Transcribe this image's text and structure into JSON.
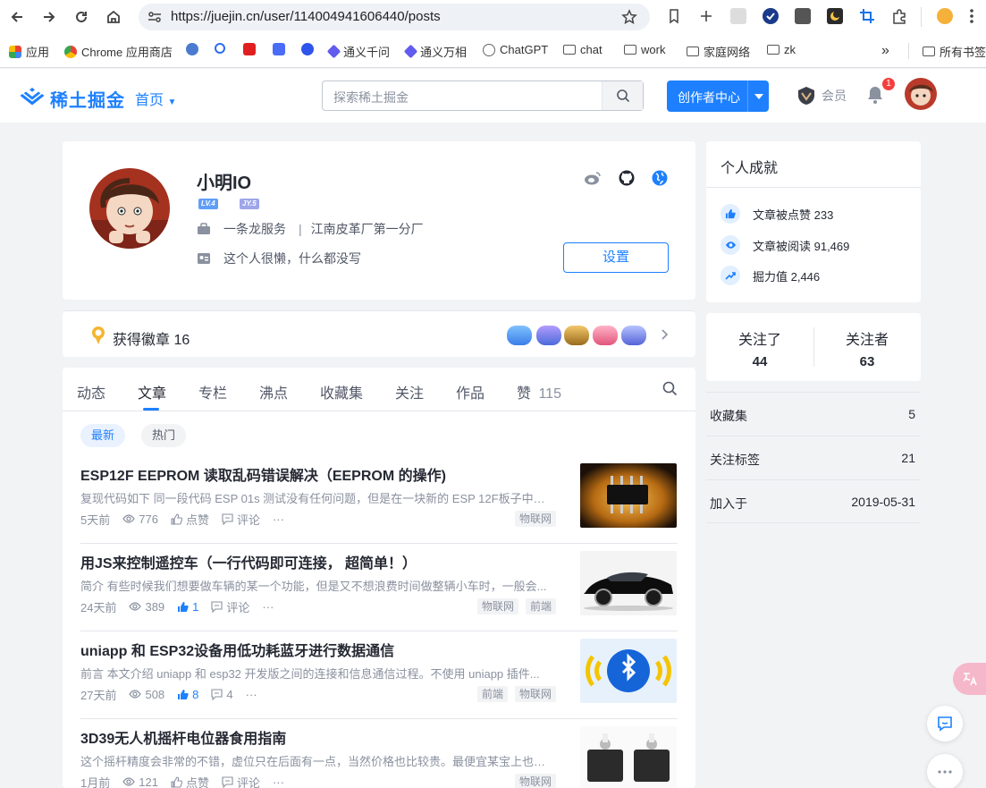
{
  "browser": {
    "url": "https://juejin.cn/user/114004941606440/posts",
    "bookmarks": [
      "应用",
      "Chrome 应用商店",
      "通义千问",
      "通义万相",
      "ChatGPT",
      "chat",
      "work",
      "家庭网络",
      "zk",
      "所有书签"
    ],
    "bookmarks_overflow": "»"
  },
  "header": {
    "logo_text": "稀土掘金",
    "nav_home": "首页",
    "search_placeholder": "探索稀土掘金",
    "creator_button": "创作者中心",
    "vip_label": "会员",
    "notification_count": "1"
  },
  "profile": {
    "name": "小明IO",
    "level_badge": "LV.4",
    "jy_badge": "JY.5",
    "job": "一条龙服务",
    "company": "江南皮革厂第一分厂",
    "bio": "这个人很懒，什么都没写",
    "settings_button": "设置",
    "badges_label": "获得徽章 16"
  },
  "tabs": [
    {
      "label": "动态"
    },
    {
      "label": "文章"
    },
    {
      "label": "专栏"
    },
    {
      "label": "沸点"
    },
    {
      "label": "收藏集"
    },
    {
      "label": "关注"
    },
    {
      "label": "作品"
    },
    {
      "label": "赞",
      "count": "115"
    }
  ],
  "filters": {
    "latest": "最新",
    "hot": "热门"
  },
  "articles": [
    {
      "title": "ESP12F EEPROM 读取乱码错误解决（EEPROM 的操作)",
      "desc": "复现代码如下 同一段代码 ESP 01s 测试没有任何问题，但是在一块新的 ESP 12F板子中出...",
      "time": "5天前",
      "views": "776",
      "likes": "点赞",
      "comments": "评论",
      "more": "···",
      "tags": [
        "物联网"
      ],
      "liked": false
    },
    {
      "title": "用JS来控制遥控车（一行代码即可连接， 超简单！）",
      "desc": "简介 有些时候我们想要做车辆的某一个功能，但是又不想浪费时间做整辆小车时，一般会...",
      "time": "24天前",
      "views": "389",
      "likes": "1",
      "comments": "评论",
      "more": "···",
      "tags": [
        "物联网",
        "前端"
      ],
      "liked": true
    },
    {
      "title": "uniapp 和 ESP32设备用低功耗蓝牙进行数据通信",
      "desc": "前言 本文介绍 uniapp 和 esp32 开发版之间的连接和信息通信过程。不使用 uniapp 插件...",
      "time": "27天前",
      "views": "508",
      "likes": "8",
      "comments": "4",
      "more": "···",
      "tags": [
        "前端",
        "物联网"
      ],
      "liked": true
    },
    {
      "title": "3D39无人机摇杆电位器食用指南",
      "desc": "这个摇杆精度会非常的不错，虚位只在后面有一点，当然价格也比较贵。最便宜某宝上也得...",
      "time": "1月前",
      "views": "121",
      "likes": "点赞",
      "comments": "评论",
      "more": "···",
      "tags": [
        "物联网"
      ],
      "liked": false
    }
  ],
  "achievements": {
    "title": "个人成就",
    "items": [
      {
        "label": "文章被点赞 233",
        "icon": "thumb-up-icon"
      },
      {
        "label": "文章被阅读 91,469",
        "icon": "eye-icon"
      },
      {
        "label": "掘力值 2,446",
        "icon": "trend-icon"
      }
    ]
  },
  "follow": {
    "following_label": "关注了",
    "following": "44",
    "followers_label": "关注者",
    "followers": "63"
  },
  "side_stats": [
    {
      "key": "收藏集",
      "value": "5"
    },
    {
      "key": "关注标签",
      "value": "21"
    },
    {
      "key": "加入于",
      "value": "2019-05-31"
    }
  ],
  "colors": {
    "brand": "#1e80ff",
    "text": "#252933",
    "muted": "#8a919f",
    "bg": "#f2f3f5"
  }
}
